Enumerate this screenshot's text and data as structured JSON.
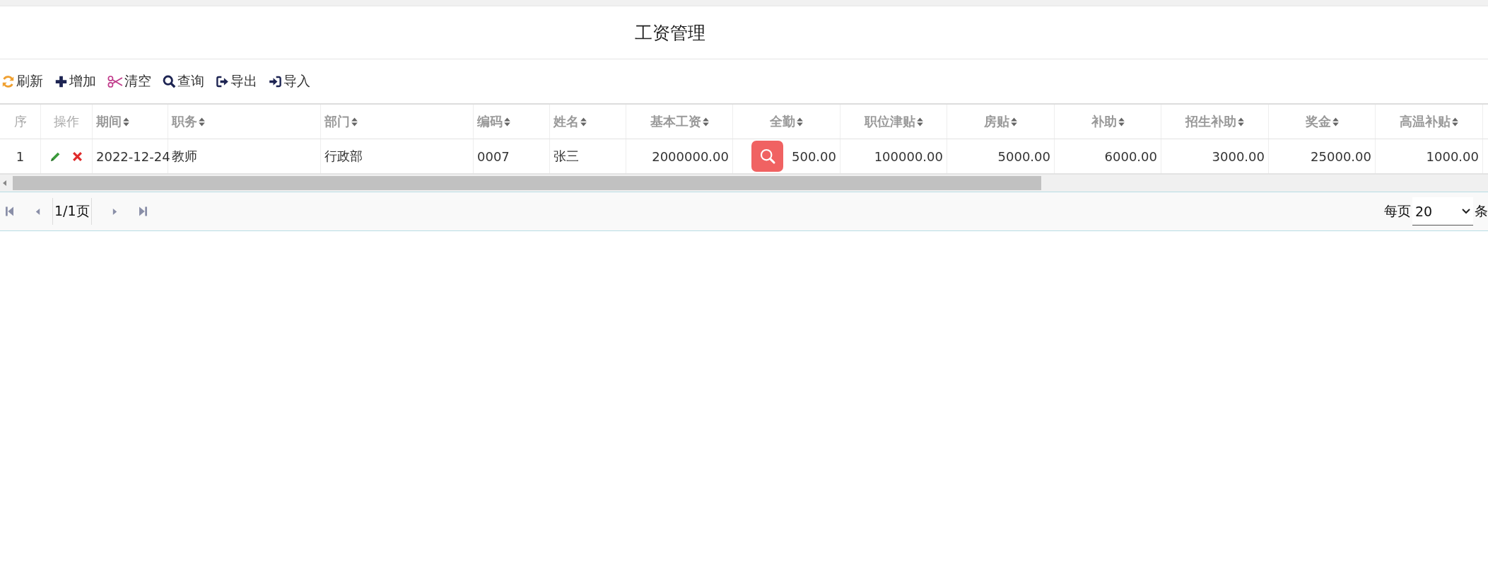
{
  "title": "工资管理",
  "toolbar": [
    {
      "label": "刷新",
      "kind": "refresh"
    },
    {
      "label": "增加",
      "kind": "add"
    },
    {
      "label": "清空",
      "kind": "clear"
    },
    {
      "label": "查询",
      "kind": "search"
    },
    {
      "label": "导出",
      "kind": "export"
    },
    {
      "label": "导入",
      "kind": "import"
    }
  ],
  "table": {
    "index_header": "序",
    "actions_header": "操作",
    "columns": [
      {
        "label": "期间",
        "kind": "text"
      },
      {
        "label": "职务",
        "kind": "text"
      },
      {
        "label": "部门",
        "kind": "text"
      },
      {
        "label": "编码",
        "kind": "text"
      },
      {
        "label": "姓名",
        "kind": "text"
      },
      {
        "label": "基本工资",
        "kind": "number"
      },
      {
        "label": "全勤",
        "kind": "number"
      },
      {
        "label": "职位津贴",
        "kind": "number"
      },
      {
        "label": "房贴",
        "kind": "number"
      },
      {
        "label": "补助",
        "kind": "number"
      },
      {
        "label": "招生补助",
        "kind": "number"
      },
      {
        "label": "奖金",
        "kind": "number"
      },
      {
        "label": "高温补贴",
        "kind": "number"
      }
    ],
    "rows": [
      {
        "index": "1",
        "cells": [
          "2022-12-24",
          "教师",
          "行政部",
          "0007",
          "张三",
          "2000000.00",
          "500.00",
          "100000.00",
          "5000.00",
          "6000.00",
          "3000.00",
          "25000.00",
          "1000.00"
        ]
      }
    ]
  },
  "pager": {
    "page": "1/1页",
    "per_page_label": "每页",
    "per_page": "20",
    "unit": "条"
  }
}
